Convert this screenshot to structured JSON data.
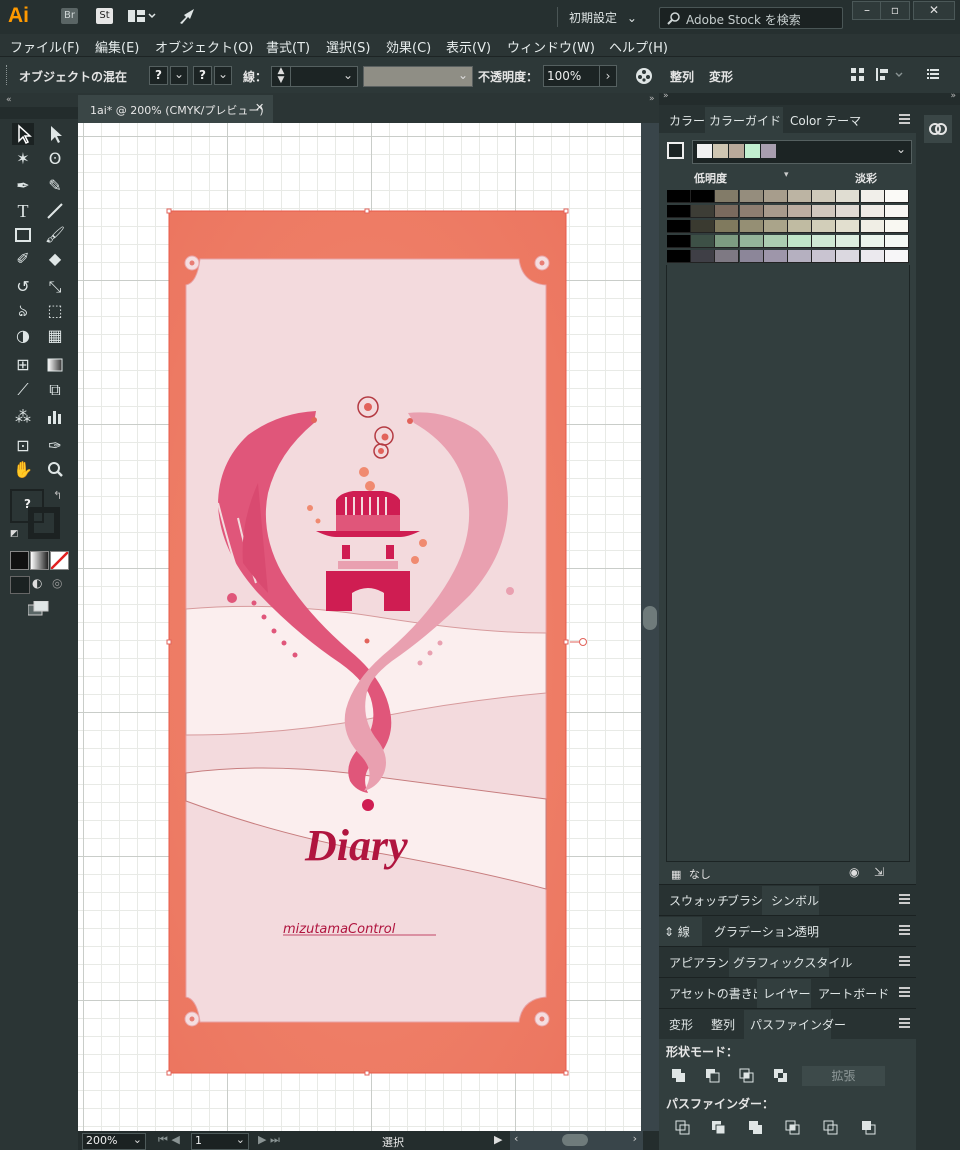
{
  "app": {
    "logo": "Ai",
    "bridge": "Br",
    "stock": "St",
    "workspace": "初期設定",
    "search_placeholder": "Adobe Stock を検索"
  },
  "menu": [
    "ファイル(F)",
    "編集(E)",
    "オブジェクト(O)",
    "書式(T)",
    "選択(S)",
    "効果(C)",
    "表示(V)",
    "ウィンドウ(W)",
    "ヘルプ(H)"
  ],
  "control": {
    "object_label": "オブジェクトの混在",
    "stroke_label": "線：",
    "opacity_label": "不透明度：",
    "opacity_value": "100%",
    "align_label": "整列",
    "transform_label": "変形",
    "unknown_mark": "?"
  },
  "document": {
    "tab_title": "1ai* @ 200% (CMYK/プレビュー)",
    "zoom": "200%",
    "page": "1",
    "status": "選択"
  },
  "artwork": {
    "title": "Diary",
    "author": "mizutamaControl",
    "colors": {
      "frame": "#ef7d66",
      "inner": "#f3dadd",
      "deep": "#cf1d52",
      "mid": "#e0567a",
      "light": "#e9a0b0"
    }
  },
  "color_guide": {
    "tabs": [
      "カラー",
      "カラーガイド",
      "Color テーマ"
    ],
    "left_label": "低明度",
    "right_label": "淡彩",
    "footer_label": "なし",
    "strip": [
      "#f2f2f2",
      "#cfc6b2",
      "#b9a99a",
      "#c2efd0",
      "#a89eaf"
    ],
    "grid": [
      [
        "#000000",
        "#000000",
        "#827b68",
        "#958d7d",
        "#a79d8c",
        "#bcb4a3",
        "#cfc9ba",
        "#e0ddd2",
        "#f1efea",
        "#fbfaf7"
      ],
      [
        "#000000",
        "#3d3d36",
        "#7a6a5e",
        "#8e7e71",
        "#a89a8c",
        "#bcada1",
        "#d0c6bd",
        "#e0d9d3",
        "#efebe6",
        "#f8f6f3"
      ],
      [
        "#000000",
        "#3a3a30",
        "#807a5e",
        "#958f74",
        "#aaa48a",
        "#c0bba2",
        "#d2ceb9",
        "#e2dfcf",
        "#f0eee5",
        "#f9f8f2"
      ],
      [
        "#000000",
        "#3d5046",
        "#7d9c82",
        "#94b49a",
        "#abcdb1",
        "#c0e5c8",
        "#cfe9d4",
        "#ddeee0",
        "#eaf4ec",
        "#f4f9f5"
      ],
      [
        "#000000",
        "#3f3f46",
        "#7e7983",
        "#8c8699",
        "#9e96aa",
        "#b5b0c0",
        "#c9c4d1",
        "#dbd8e0",
        "#ebe9ee",
        "#f7f6f8"
      ]
    ]
  },
  "panels": {
    "row1": [
      "スウォッチ",
      "ブラシ",
      "シンボル"
    ],
    "row2": [
      "線",
      "グラデーション",
      "透明"
    ],
    "row3": [
      "アピアランス",
      "グラフィックスタイル"
    ],
    "row4": [
      "アセットの書き出し",
      "レイヤー",
      "アートボード"
    ],
    "row5": [
      "変形",
      "整列",
      "パスファインダー"
    ],
    "shape_modes": "形状モード：",
    "expand": "拡張",
    "pathfinders": "パスファインダー："
  }
}
